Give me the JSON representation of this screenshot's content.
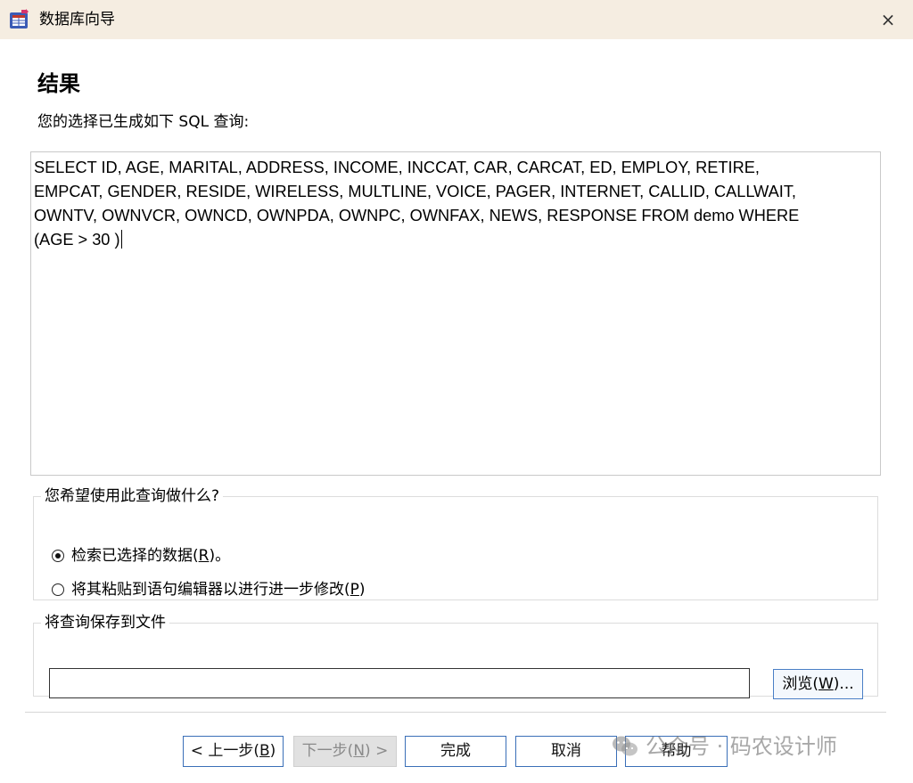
{
  "window": {
    "title": "数据库向导",
    "close_glyph": "×"
  },
  "page": {
    "heading": "结果",
    "subheading": "您的选择已生成如下 SQL 查询:"
  },
  "sql": {
    "query": "SELECT ID, AGE, MARITAL, ADDRESS, INCOME, INCCAT, CAR, CARCAT, ED, EMPLOY, RETIRE,\nEMPCAT, GENDER, RESIDE, WIRELESS, MULTLINE, VOICE, PAGER, INTERNET, CALLID, CALLWAIT,\nOWNTV, OWNVCR, OWNCD, OWNPDA, OWNPC, OWNFAX, NEWS, RESPONSE FROM demo WHERE\n(AGE > 30 )"
  },
  "usage": {
    "legend": "您希望使用此查询做什么?",
    "options": [
      {
        "label_pre": "检索已选择的数据(",
        "mnemonic": "R",
        "label_post": ")。",
        "checked": true
      },
      {
        "label_pre": "将其粘贴到语句编辑器以进行进一步修改(",
        "mnemonic": "P",
        "label_post": ")",
        "checked": false
      }
    ]
  },
  "save": {
    "legend": "将查询保存到文件",
    "path_value": "",
    "browse_pre": "浏览(",
    "browse_mnemonic": "W",
    "browse_post": ")..."
  },
  "buttons": {
    "back_pre": "< 上一步(",
    "back_mnemonic": "B",
    "back_post": ")",
    "next_pre": "下一步(",
    "next_mnemonic": "N",
    "next_post": ") >",
    "finish": "完成",
    "cancel": "取消",
    "help": "帮助"
  },
  "watermark": {
    "text": "公众号 · 码农设计师"
  },
  "icons": {
    "app": "database-wizard-icon",
    "close": "close-icon",
    "watermark": "wechat-icon"
  },
  "colors": {
    "titlebar": "#f5ede1",
    "button_border": "#3a6fb8",
    "disabled_button": "#e1e1e1"
  }
}
